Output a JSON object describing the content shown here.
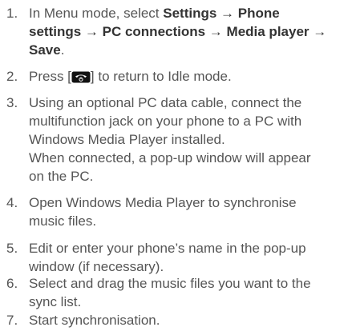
{
  "steps": [
    {
      "number": "1.",
      "line1_a": "In Menu mode, select ",
      "line1_b": "Settings → Phone",
      "line2": "settings → PC connections → Media player →",
      "line3": "Save",
      "line3_end": "."
    },
    {
      "number": "2.",
      "before": "Press [",
      "icon": "end-call-power-key-icon",
      "after": "] to return to Idle mode."
    },
    {
      "number": "3.",
      "lines": [
        "Using an optional PC data cable, connect the",
        "multifunction jack on your phone to a PC with",
        "Windows Media Player installed.",
        "When connected, a pop-up window will appear",
        "on the PC."
      ]
    },
    {
      "number": "4.",
      "lines": [
        "Open Windows Media Player to synchronise",
        "music files."
      ]
    },
    {
      "number": "5.",
      "lines": [
        "Edit or enter your phone’s name in the pop-up",
        "window (if necessary)."
      ]
    },
    {
      "number": "6.",
      "lines": [
        "Select and drag the music files you want to the",
        "sync list."
      ]
    },
    {
      "number": "7.",
      "lines": [
        "Start synchronisation."
      ]
    }
  ]
}
